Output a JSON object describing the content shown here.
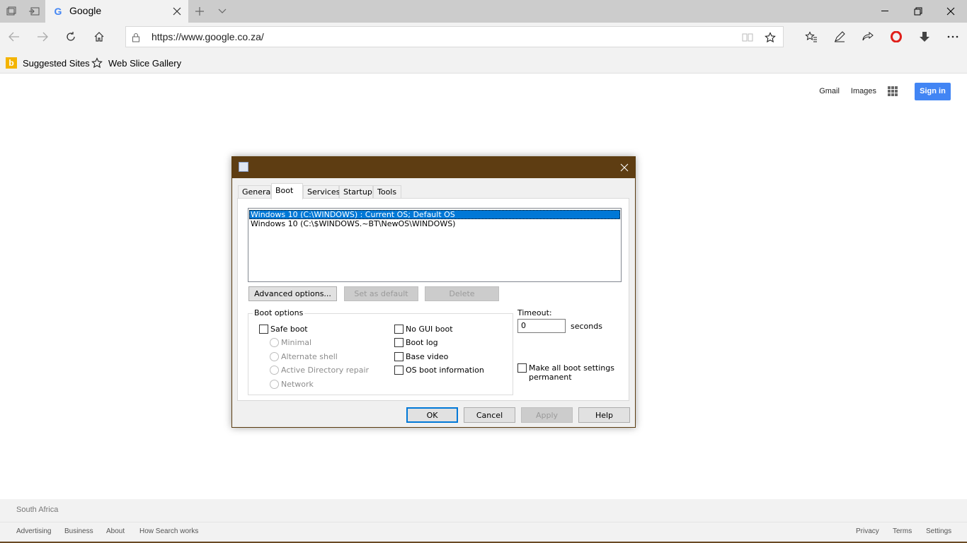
{
  "browser": {
    "tab_title": "Google",
    "url": "https://www.google.co.za/",
    "favorites": [
      {
        "label": "Suggested Sites",
        "icon": "bing-icon"
      },
      {
        "label": "Web Slice Gallery",
        "icon": "star-icon"
      }
    ]
  },
  "google": {
    "links": {
      "gmail": "Gmail",
      "images": "Images"
    },
    "signin": "Sign in",
    "footer": {
      "country": "South Africa",
      "left_links": [
        "Advertising",
        "Business",
        "About",
        "How Search works"
      ],
      "right_links": [
        "Privacy",
        "Terms",
        "Settings"
      ]
    }
  },
  "dialog": {
    "tabs": [
      "General",
      "Boot",
      "Services",
      "Startup",
      "Tools"
    ],
    "active_tab": "Boot",
    "os_entries": [
      "Windows 10 (C:\\WINDOWS) : Current OS; Default OS",
      "Windows 10 (C:\\$WINDOWS.~BT\\NewOS\\WINDOWS)"
    ],
    "buttons": {
      "advanced": "Advanced options...",
      "set_default": "Set as default",
      "delete": "Delete",
      "ok": "OK",
      "cancel": "Cancel",
      "apply": "Apply",
      "help": "Help"
    },
    "boot_options": {
      "label": "Boot options",
      "safe_boot": "Safe boot",
      "minimal": "Minimal",
      "alternate_shell": "Alternate shell",
      "ad_repair": "Active Directory repair",
      "network": "Network",
      "no_gui": "No GUI boot",
      "boot_log": "Boot log",
      "base_video": "Base video",
      "os_boot_info": "OS boot information"
    },
    "timeout": {
      "label": "Timeout:",
      "value": "0",
      "unit": "seconds"
    },
    "make_permanent_line1": "Make all boot settings",
    "make_permanent_line2": "permanent"
  }
}
